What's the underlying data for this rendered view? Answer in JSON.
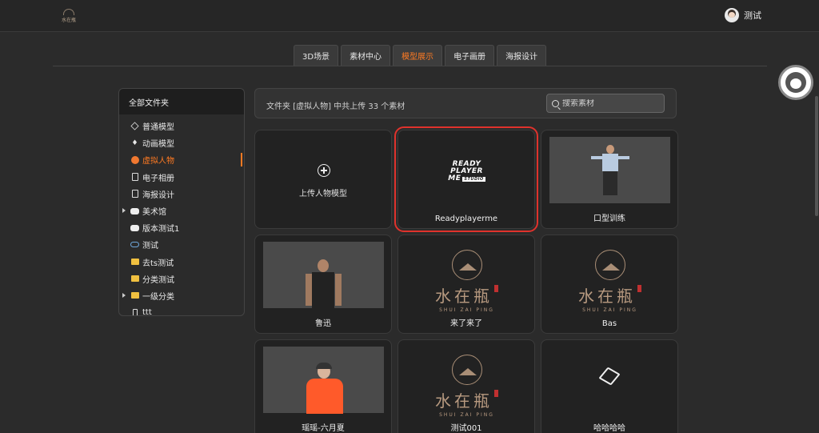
{
  "header": {
    "logo_text": "水在瓶",
    "user_name": "测试"
  },
  "tabs": [
    {
      "label": "3D场景",
      "active": false
    },
    {
      "label": "素材中心",
      "active": false
    },
    {
      "label": "模型展示",
      "active": true
    },
    {
      "label": "电子画册",
      "active": false
    },
    {
      "label": "海报设计",
      "active": false
    }
  ],
  "sidebar": {
    "title": "全部文件夹",
    "items": [
      {
        "label": "普通模型",
        "icon": "cube-icon"
      },
      {
        "label": "动画模型",
        "icon": "rocket-icon"
      },
      {
        "label": "虚拟人物",
        "icon": "person-icon",
        "active": true
      },
      {
        "label": "电子相册",
        "icon": "album-icon"
      },
      {
        "label": "海报设计",
        "icon": "poster-icon"
      },
      {
        "label": "美术馆",
        "icon": "gallery-icon",
        "expandable": true
      },
      {
        "label": "版本测试1",
        "icon": "version-icon"
      },
      {
        "label": "测试",
        "icon": "cloud-icon"
      },
      {
        "label": "去ts测试",
        "icon": "folder-icon"
      },
      {
        "label": "分类测试",
        "icon": "folder-icon"
      },
      {
        "label": "一级分类",
        "icon": "folder-icon",
        "expandable": true
      },
      {
        "label": "ttt",
        "icon": "phone-icon"
      }
    ]
  },
  "toolbar": {
    "info": "文件夹 [虚拟人物] 中共上传 33 个素材",
    "search_placeholder": "搜索素材"
  },
  "cards": {
    "upload_label": "上传人物模型",
    "rpm_line1": "READY",
    "rpm_line2": "PLAYER",
    "rpm_line3": "ME",
    "rpm_studio": "STUDIO",
    "brand_cn": "水在瓶",
    "brand_en": "SHUI ZAI PING",
    "items": [
      {
        "label": "Readyplayerme"
      },
      {
        "label": "口型训练"
      },
      {
        "label": "鲁迅"
      },
      {
        "label": "来了来了"
      },
      {
        "label": "Bas"
      },
      {
        "label": "瑶瑶-六月夏"
      },
      {
        "label": "测试001"
      },
      {
        "label": "哈哈哈哈"
      }
    ]
  }
}
